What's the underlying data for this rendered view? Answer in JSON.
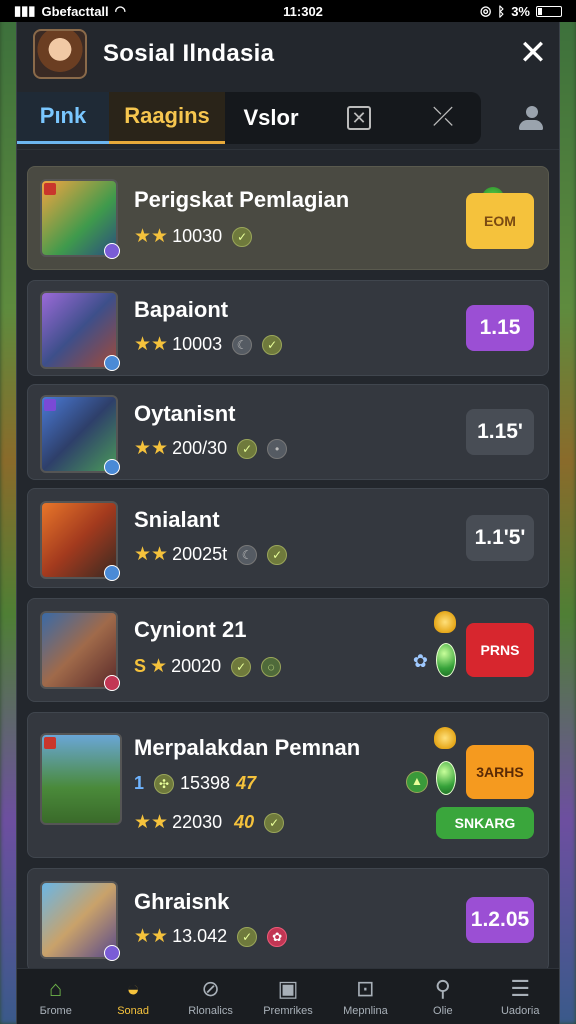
{
  "status_bar": {
    "carrier": "Gbefacttall",
    "time": "11:302",
    "battery": "3%"
  },
  "header": {
    "title": "Sosial Ilndasia"
  },
  "tabs": [
    {
      "label": "Pınk"
    },
    {
      "label": "Raagins"
    },
    {
      "label": "Vslor"
    }
  ],
  "rows": [
    {
      "name": "Perigskat Pemlagian",
      "score": "10030",
      "button_label": "ЕОМ"
    },
    {
      "name": "Bapaiont",
      "score": "10003",
      "button_label": "1.15"
    },
    {
      "name": "Oytanisnt",
      "score": "200/30",
      "button_label": "1.15'"
    },
    {
      "name": "Snialant",
      "score": "20025t",
      "button_label": "1.1'5'"
    },
    {
      "name": "Cyniont 21",
      "prefix": "Ѕ",
      "score": "20020",
      "button_label": "PRNS"
    },
    {
      "name": "Merpalakdan Pemnan",
      "sub_count": "1",
      "sub_value": "15398",
      "sub_gold": "47",
      "score": "22030",
      "score_gold": "40",
      "button_label": "3ARHS",
      "secondary_button_label": "SNKARG"
    },
    {
      "name": "Ghraisnk",
      "score": "13.042",
      "button_label": "1.2.05"
    }
  ],
  "bottom_nav": [
    {
      "label": "Бrome",
      "icon": "home-icon"
    },
    {
      "label": "Sonad",
      "icon": "controller-icon"
    },
    {
      "label": "Rlonalics",
      "icon": "compass-icon"
    },
    {
      "label": "Premrikes",
      "icon": "card-icon"
    },
    {
      "label": "Mepnlina",
      "icon": "frame-icon"
    },
    {
      "label": "Olie",
      "icon": "search-icon"
    },
    {
      "label": "Uadoria",
      "icon": "profile-icon"
    }
  ],
  "colors": {
    "panel": "#23272d",
    "tab_active_blue": "#7ac7ff",
    "tab_active_gold": "#f6c64f",
    "button_yellow": "#f5c23c",
    "button_purple": "#9b4fd4",
    "button_red": "#d7262e",
    "button_orange": "#f59a1f",
    "button_green": "#3aa63c"
  }
}
